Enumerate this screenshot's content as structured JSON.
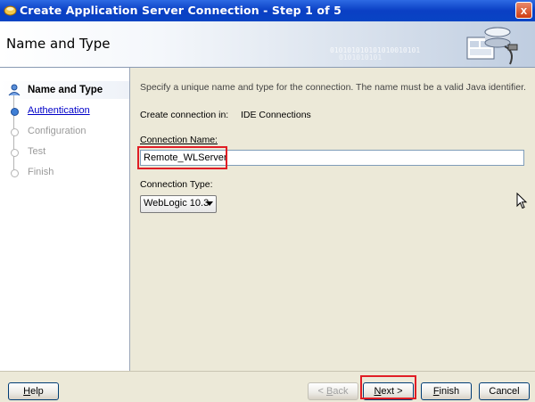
{
  "window": {
    "title": "Create Application Server Connection - Step 1 of 5",
    "close_glyph": "x"
  },
  "header": {
    "heading": "Name and Type",
    "binary_line1": "010101010101010010101",
    "binary_line2": "0101010101"
  },
  "steps": [
    {
      "label": "Name and Type",
      "state": "active"
    },
    {
      "label": "Authentication",
      "state": "link"
    },
    {
      "label": "Configuration",
      "state": "disabled"
    },
    {
      "label": "Test",
      "state": "disabled"
    },
    {
      "label": "Finish",
      "state": "disabled"
    }
  ],
  "main": {
    "instructions": "Specify a unique name and type for the connection. The name must be a valid Java identifier.",
    "create_in_label": "Create connection in:",
    "create_in_value": "IDE Connections",
    "connection_name_label": "Connection Name:",
    "connection_name_value": "Remote_WLServer",
    "connection_type_label": "Connection Type:",
    "connection_type_value": "WebLogic 10.3"
  },
  "footer": {
    "help": {
      "first": "H",
      "rest": "elp"
    },
    "back": {
      "prefix": "< ",
      "u": "B",
      "rest": "ack"
    },
    "next": {
      "u": "N",
      "rest": "ext >"
    },
    "finish": {
      "u": "F",
      "rest": "inish"
    },
    "cancel": "Cancel"
  },
  "colors": {
    "title_bar": "#0a3fc4",
    "highlight": "#e01e25",
    "link": "#0000c8"
  }
}
